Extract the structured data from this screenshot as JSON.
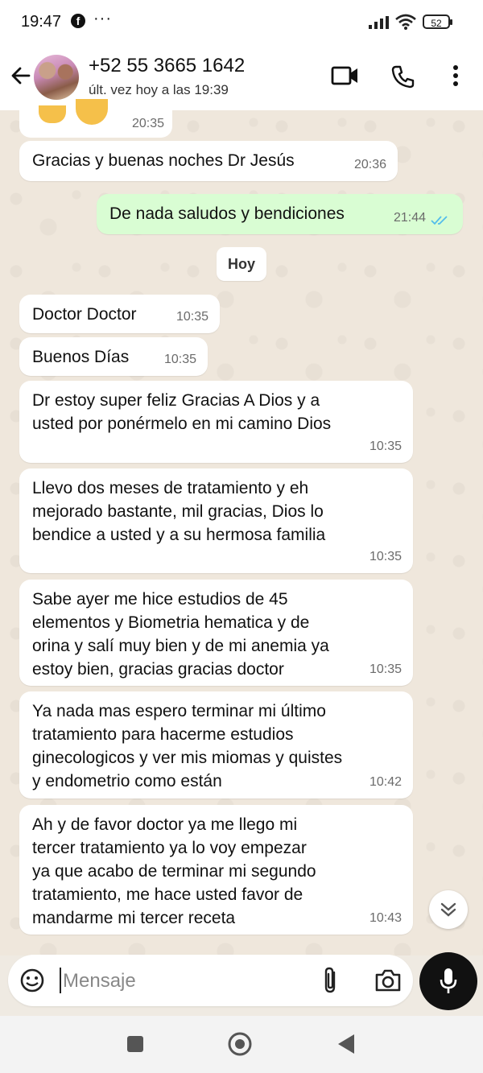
{
  "status_bar": {
    "time": "19:47",
    "battery": "52"
  },
  "header": {
    "contact_name": "+52 55 3665 1642",
    "last_seen": "últ. vez hoy a las 19:39"
  },
  "top_partial_message": {
    "time": "20:35"
  },
  "messages": [
    {
      "direction": "in",
      "text": "Gracias y buenas noches Dr Jesús",
      "time": "20:36"
    },
    {
      "direction": "out",
      "text": "De nada saludos y bendiciones",
      "time": "21:44",
      "status": "read"
    },
    {
      "direction": "in",
      "text": "Doctor Doctor",
      "time": "10:35"
    },
    {
      "direction": "in",
      "text": "Buenos Días",
      "time": "10:35"
    },
    {
      "direction": "in",
      "text": "Dr estoy super feliz Gracias A Dios y a\nusted por ponérmelo en mi camino Dios",
      "time": "10:35"
    },
    {
      "direction": "in",
      "text": "Llevo dos meses de tratamiento y eh\nmejorado bastante, mil gracias, Dios lo\nbendice a usted y a su hermosa familia",
      "time": "10:35"
    },
    {
      "direction": "in",
      "text": "Sabe ayer me hice estudios de 45\nelementos y Biometria hematica y de\norina y salí muy bien y de mi anemia ya\nestoy bien, gracias gracias doctor",
      "time": "10:35"
    },
    {
      "direction": "in",
      "text": "Ya nada mas espero terminar mi último\ntratamiento para hacerme estudios\nginecologicos y ver mis miomas y quistes\ny endometrio como están",
      "time": "10:42"
    },
    {
      "direction": "in",
      "text": "Ah y de favor doctor ya me llego mi\ntercer tratamiento ya lo voy empezar\nya que acabo de terminar mi segundo\ntratamiento, me hace usted favor de\nmandarme mi tercer receta",
      "time": "10:43"
    }
  ],
  "date_chip": "Hoy",
  "composer": {
    "placeholder": "Mensaje"
  },
  "colors": {
    "incoming_bubble": "#ffffff",
    "outgoing_bubble": "#d9fdd3",
    "read_ticks": "#53bdeb",
    "mic_button": "#111111"
  },
  "icons": {
    "header": [
      "back-arrow-icon",
      "video-call-icon",
      "phone-icon",
      "more-vert-icon"
    ],
    "composer": [
      "sticker-icon",
      "attach-icon",
      "camera-icon",
      "mic-icon"
    ],
    "navigation": [
      "recents-icon",
      "home-icon",
      "back-icon"
    ]
  }
}
